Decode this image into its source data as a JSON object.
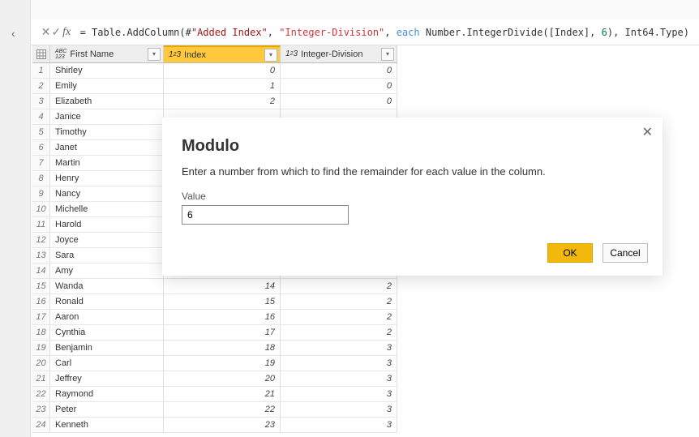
{
  "formula_bar": {
    "prefix_eq": "= ",
    "fn1": "Table.AddColumn",
    "paren_open": "(#",
    "str_added_index": "\"Added Index\"",
    "comma1": ", ",
    "str_intdiv": "\"Integer-Division\"",
    "comma2": ", ",
    "each_kw": "each ",
    "fn2": "Number.IntegerDivide",
    "paren2_open": "([Index], ",
    "num6": "6",
    "paren2_close": "), Int64.Type)"
  },
  "columns": {
    "first_name": "First Name",
    "index": "Index",
    "intdiv": "Integer-Division"
  },
  "type_icons": {
    "abc": "ABC\n123",
    "int": "1²3"
  },
  "rows": [
    {
      "n": "1",
      "name": "Shirley",
      "index": "0",
      "intdiv": "0"
    },
    {
      "n": "2",
      "name": "Emily",
      "index": "1",
      "intdiv": "0"
    },
    {
      "n": "3",
      "name": "Elizabeth",
      "index": "2",
      "intdiv": "0"
    },
    {
      "n": "4",
      "name": "Janice",
      "index": "",
      "intdiv": ""
    },
    {
      "n": "5",
      "name": "Timothy",
      "index": "",
      "intdiv": ""
    },
    {
      "n": "6",
      "name": "Janet",
      "index": "",
      "intdiv": ""
    },
    {
      "n": "7",
      "name": "Martin",
      "index": "",
      "intdiv": ""
    },
    {
      "n": "8",
      "name": "Henry",
      "index": "",
      "intdiv": ""
    },
    {
      "n": "9",
      "name": "Nancy",
      "index": "",
      "intdiv": ""
    },
    {
      "n": "10",
      "name": "Michelle",
      "index": "",
      "intdiv": ""
    },
    {
      "n": "11",
      "name": "Harold",
      "index": "",
      "intdiv": ""
    },
    {
      "n": "12",
      "name": "Joyce",
      "index": "",
      "intdiv": ""
    },
    {
      "n": "13",
      "name": "Sara",
      "index": "",
      "intdiv": ""
    },
    {
      "n": "14",
      "name": "Amy",
      "index": "",
      "intdiv": ""
    },
    {
      "n": "15",
      "name": "Wanda",
      "index": "14",
      "intdiv": "2"
    },
    {
      "n": "16",
      "name": "Ronald",
      "index": "15",
      "intdiv": "2"
    },
    {
      "n": "17",
      "name": "Aaron",
      "index": "16",
      "intdiv": "2"
    },
    {
      "n": "18",
      "name": "Cynthia",
      "index": "17",
      "intdiv": "2"
    },
    {
      "n": "19",
      "name": "Benjamin",
      "index": "18",
      "intdiv": "3"
    },
    {
      "n": "20",
      "name": "Carl",
      "index": "19",
      "intdiv": "3"
    },
    {
      "n": "21",
      "name": "Jeffrey",
      "index": "20",
      "intdiv": "3"
    },
    {
      "n": "22",
      "name": "Raymond",
      "index": "21",
      "intdiv": "3"
    },
    {
      "n": "23",
      "name": "Peter",
      "index": "22",
      "intdiv": "3"
    },
    {
      "n": "24",
      "name": "Kenneth",
      "index": "23",
      "intdiv": "3"
    }
  ],
  "dialog": {
    "title": "Modulo",
    "description": "Enter a number from which to find the remainder for each value in the column.",
    "value_label": "Value",
    "value_input": "6",
    "ok": "OK",
    "cancel": "Cancel"
  },
  "icons": {
    "cancel": "✕",
    "check": "✓",
    "fx": "fx",
    "chevron_left": "‹",
    "dropdown": "▾",
    "close": "✕"
  }
}
